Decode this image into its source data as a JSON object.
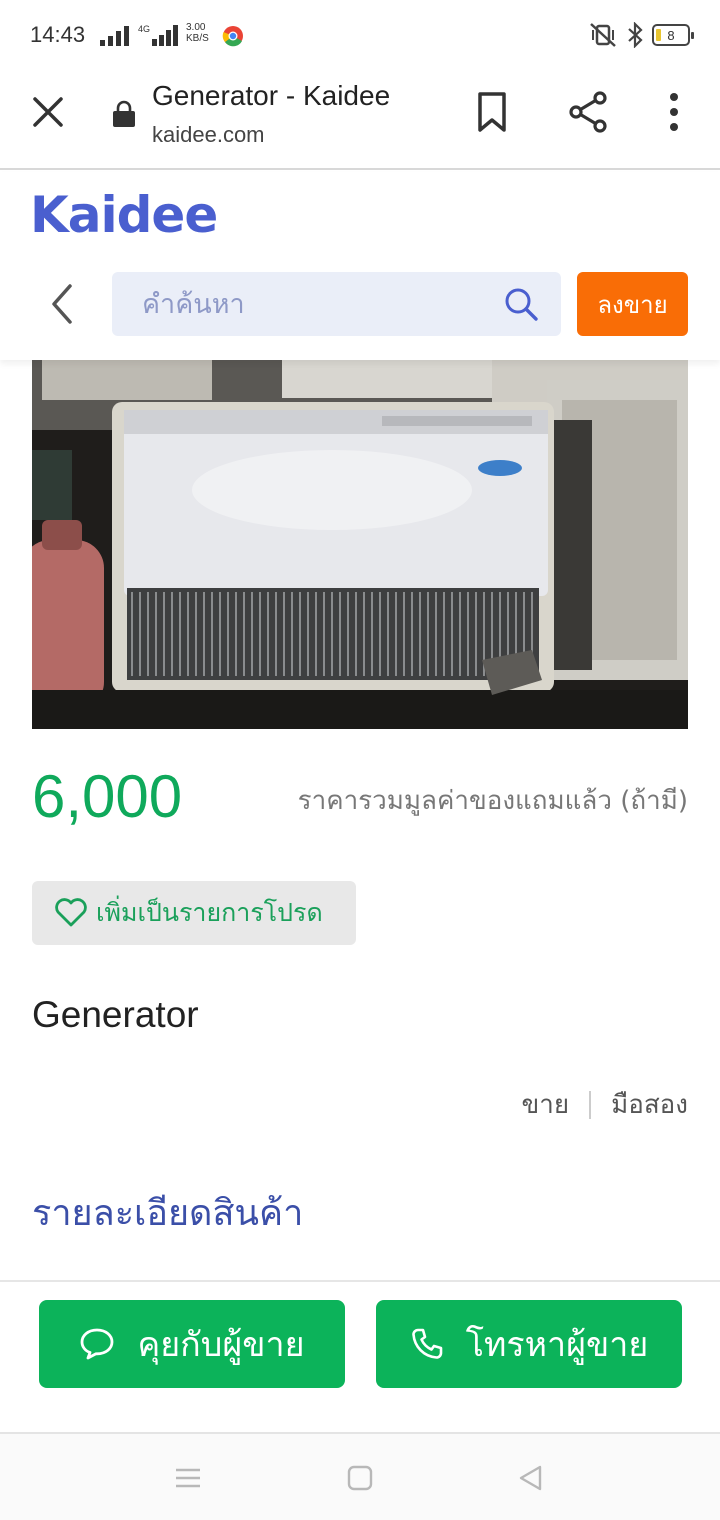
{
  "status_bar": {
    "time": "14:43",
    "network_type": "4G",
    "speed_value": "3.00",
    "speed_unit": "KB/S",
    "battery": "8"
  },
  "browser": {
    "page_title": "Generator - Kaidee",
    "url": "kaidee.com"
  },
  "site": {
    "logo": "Kaidee",
    "search_placeholder": "คำค้นหา",
    "sell_button": "ลงขาย"
  },
  "listing": {
    "price": "6,000",
    "price_note": "ราคารวมมูลค่าของแถมแล้ว (ถ้ามี)",
    "favorite_label": "เพิ่มเป็นรายการโปรด",
    "title": "Generator",
    "tag_type": "ขาย",
    "tag_condition": "มือสอง",
    "details_heading": "รายละเอียดสินค้า"
  },
  "actions": {
    "chat_label": "คุยกับผู้ขาย",
    "call_label": "โทรหาผู้ขาย"
  },
  "colors": {
    "brand": "#4a5fcf",
    "sell": "#f96d06",
    "green": "#0cb35a",
    "price": "#0fa95b"
  },
  "icons": {
    "close": "close-icon",
    "lock": "lock-icon",
    "bookmark": "bookmark-icon",
    "share": "share-icon",
    "menu": "more-vert-icon",
    "back": "chevron-left-icon",
    "search": "search-icon",
    "heart": "heart-icon",
    "chat": "chat-bubble-icon",
    "phone": "phone-icon"
  }
}
